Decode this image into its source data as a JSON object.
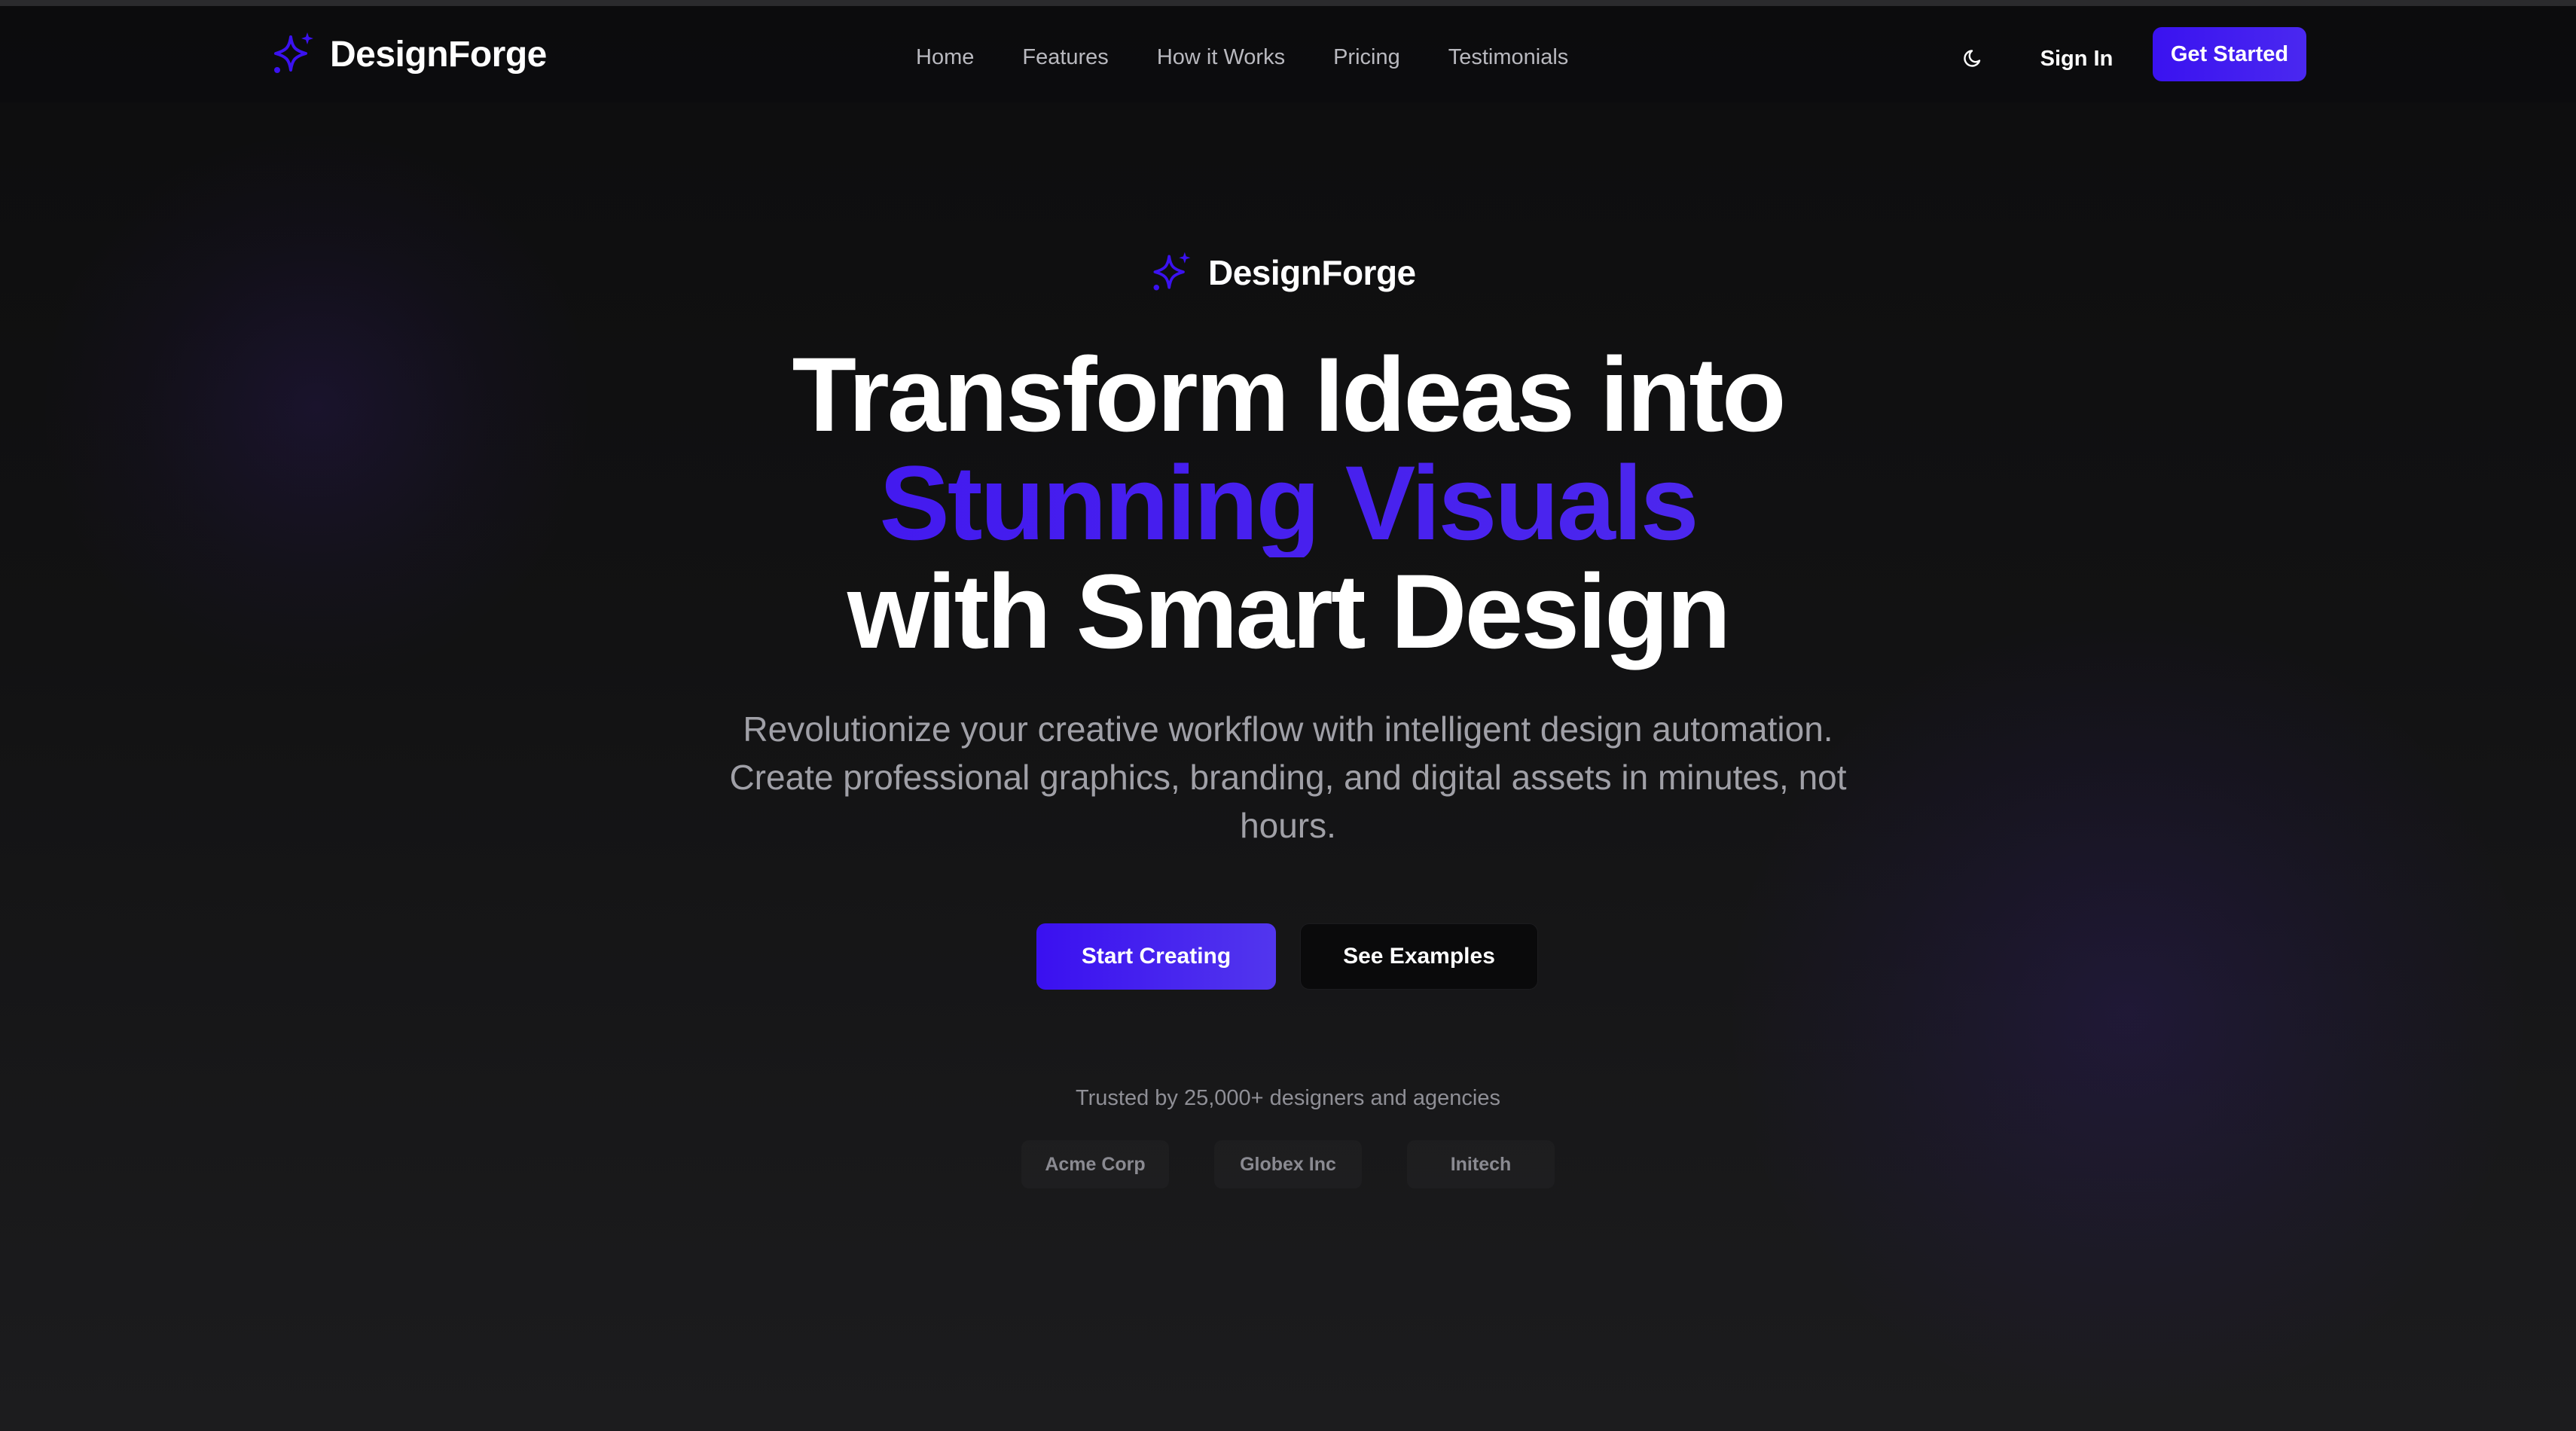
{
  "brand": {
    "name": "DesignForge",
    "icon": "sparkle-icon",
    "accent_color": "#3b12f0"
  },
  "nav": {
    "links": [
      "Home",
      "Features",
      "How it Works",
      "Pricing",
      "Testimonials"
    ],
    "theme_toggle_icon": "moon-icon",
    "sign_in_label": "Sign In",
    "get_started_label": "Get Started"
  },
  "hero": {
    "brand_name": "DesignForge",
    "headline_line1": "Transform Ideas into",
    "headline_accent": "Stunning Visuals",
    "headline_line3": "with Smart Design",
    "subtext": "Revolutionize your creative workflow with intelligent design automation. Create professional graphics, branding, and digital assets in minutes, not hours.",
    "primary_cta": "Start Creating",
    "secondary_cta": "See Examples"
  },
  "trust": {
    "text": "Trusted by 25,000+ designers and agencies",
    "logos": [
      "Acme Corp",
      "Globex Inc",
      "Initech"
    ]
  }
}
